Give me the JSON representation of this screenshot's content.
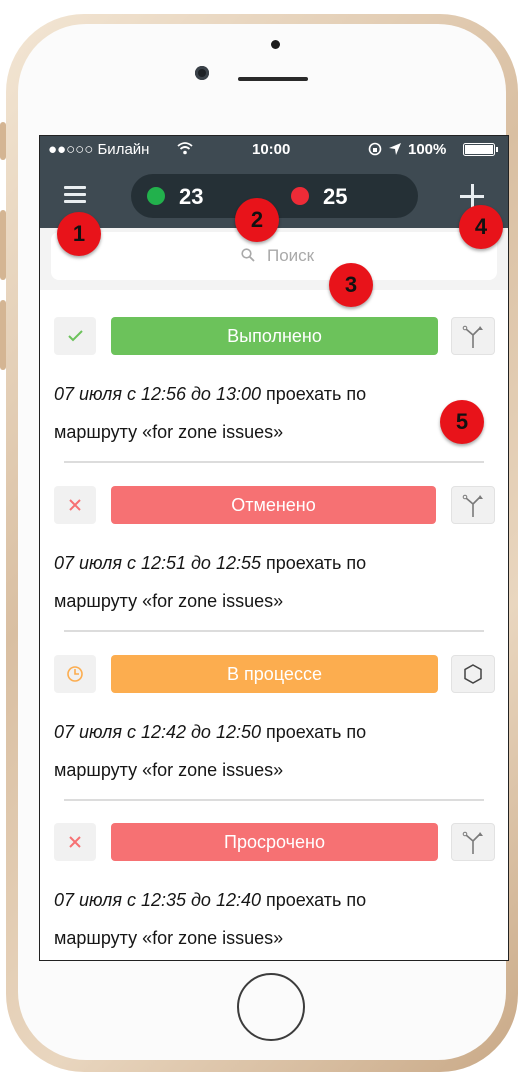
{
  "status_bar": {
    "carrier": "●●○○○ Билайн",
    "time": "10:00",
    "battery": "100%"
  },
  "navbar": {
    "menu_icon": "hamburger-menu-icon",
    "green_count": "23",
    "red_count": "25",
    "add_icon": "plus-icon",
    "colors": {
      "bar": "#3e4a52",
      "pill": "#253036",
      "green": "#22b14c",
      "red": "#ee2b37"
    }
  },
  "search": {
    "placeholder": "Поиск",
    "icon": "magnifier-icon"
  },
  "tasks": [
    {
      "state_icon": "check-icon",
      "status": "Выполнено",
      "status_color": "#6cc25b",
      "route_icon": "route-fork-icon",
      "date": "07 июля с 12:56 до 13:00",
      "text_a": " проехать по",
      "text_b": "маршруту «for zone issues»"
    },
    {
      "state_icon": "cross-icon",
      "status": "Отменено",
      "status_color": "#f67173",
      "route_icon": "route-fork-icon",
      "date": "07 июля с 12:51 до 12:55",
      "text_a": " проехать по",
      "text_b": "маршруту «for zone issues»"
    },
    {
      "state_icon": "clock-icon",
      "status": "В процессе",
      "status_color": "#fcad4f",
      "route_icon": "hexagon-zone-icon",
      "date": "07 июля с 12:42 до 12:50",
      "text_a": " проехать по",
      "text_b": "маршруту «for zone issues»"
    },
    {
      "state_icon": "cross-icon",
      "status": "Просрочено",
      "status_color": "#f67173",
      "route_icon": "route-fork-icon",
      "date": "07 июля с 12:35 до 12:40",
      "text_a": " проехать по",
      "text_b": "маршруту «for zone issues»"
    }
  ],
  "callouts": [
    "1",
    "2",
    "3",
    "4",
    "5"
  ]
}
